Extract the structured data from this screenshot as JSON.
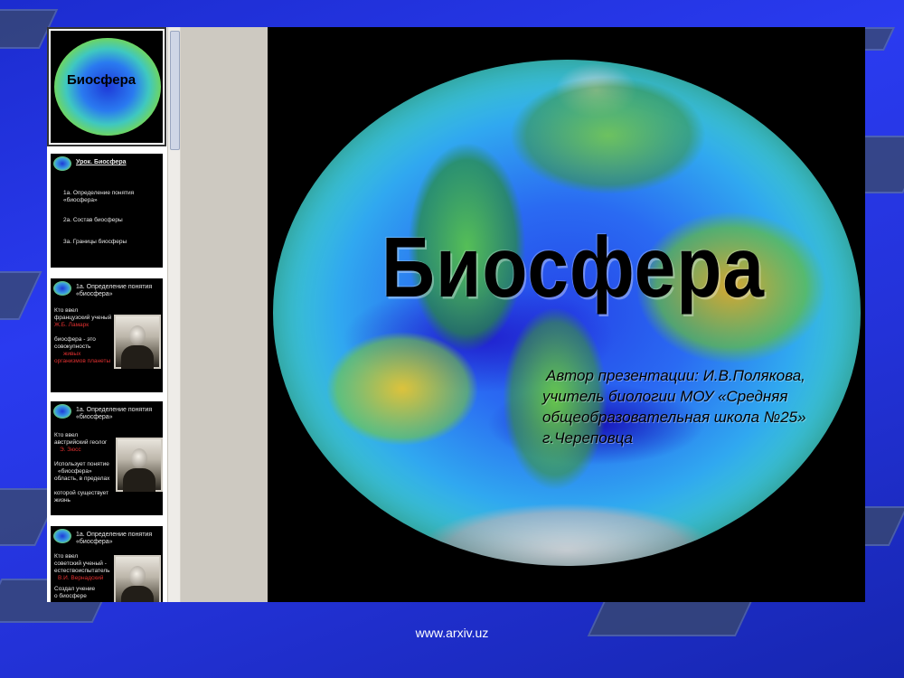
{
  "slide": {
    "title": "Биосфера",
    "author_lines": [
      "Автор презентации: И.В.Полякова,",
      "учитель биологии МОУ «Средняя",
      "общеобразовательная школа №25»",
      "г.Череповца"
    ]
  },
  "thumbnails": [
    {
      "title": "Биосфера"
    },
    {
      "heading": "Урок. Биосфера",
      "items": [
        "1а. Определение понятия «биосфера»",
        "2а. Состав биосферы",
        "3а. Границы биосферы"
      ]
    },
    {
      "heading": "1а. Определение понятия «биосфера»",
      "lines": [
        "Кто ввел",
        "французский ученый",
        "Ж.Б. Ламарк",
        "биосфера - это",
        "совокупность",
        "живых",
        "организмов планеты"
      ]
    },
    {
      "heading": "1а. Определение понятия «биосфера»",
      "lines": [
        "Кто ввел",
        "австрийский геолог",
        "Э. Зюсс",
        "Использует понятие",
        "«биосфера»",
        "область, в пределах",
        "которой существует жизнь"
      ]
    },
    {
      "heading": "1а. Определение понятия «биосфера»",
      "lines": [
        "Кто ввел",
        "советский ученый -",
        "естествоиспытатель",
        "В.И. Вернадский",
        "Создал учение",
        "о биосфере"
      ]
    }
  ],
  "footer": {
    "url": "www.arxiv.uz"
  }
}
